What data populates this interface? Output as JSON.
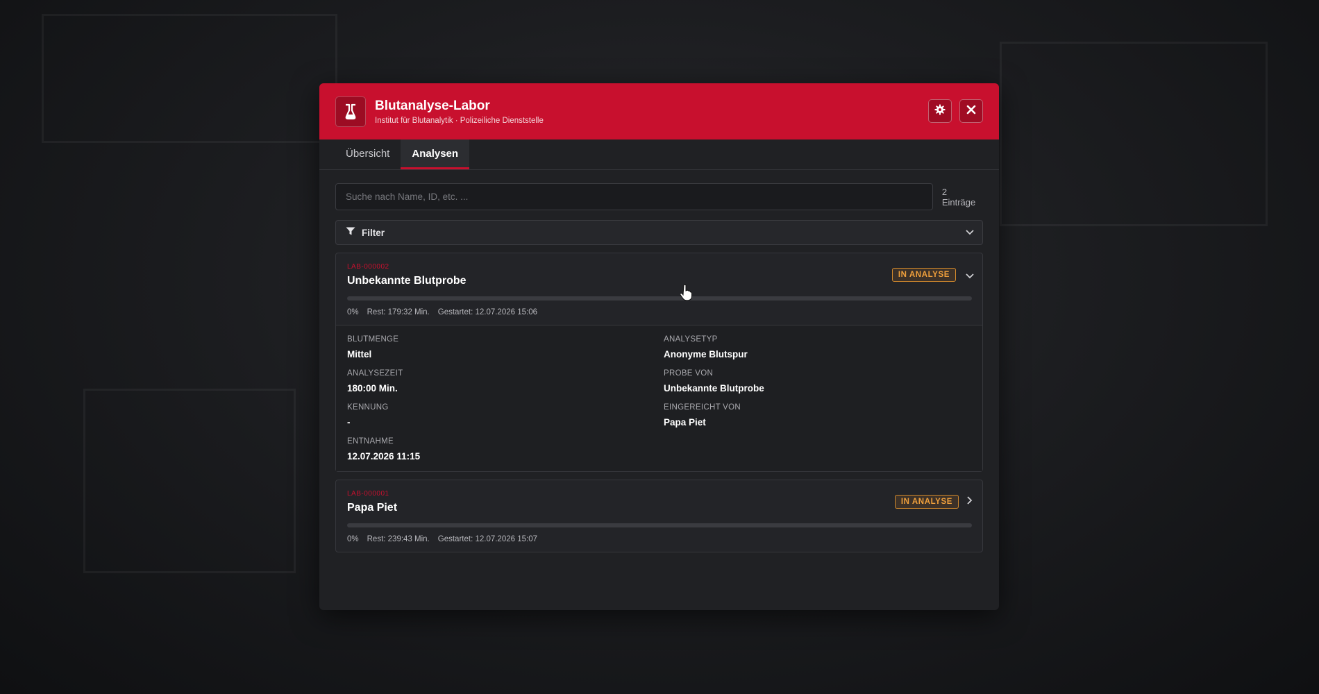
{
  "header": {
    "title": "Blutanalyse-Labor",
    "subtitle": "Institut für Blutanalytik · Polizeiliche Dienststelle"
  },
  "tabs": [
    {
      "label": "Übersicht",
      "active": false
    },
    {
      "label": "Analysen",
      "active": true
    }
  ],
  "search": {
    "placeholder": "Suche nach Name, ID, etc. ...",
    "value": "",
    "count_label": "2 Einträge"
  },
  "filter": {
    "label": "Filter"
  },
  "analyses": [
    {
      "id": "LAB-000002",
      "name": "Unbekannte Blutprobe",
      "status": "IN ANALYSE",
      "progress_percent": 0,
      "progress_label": "0%",
      "rest_label": "Rest: 179:32 Min.",
      "started_label": "Gestartet: 12.07.2026 15:06",
      "expanded": true,
      "details": {
        "blutmenge_label": "BLUTMENGE",
        "blutmenge": "Mittel",
        "analysetyp_label": "ANALYSETYP",
        "analysetyp": "Anonyme Blutspur",
        "analysezeit_label": "ANALYSEZEIT",
        "analysezeit": "180:00 Min.",
        "probe_von_label": "PROBE VON",
        "probe_von": "Unbekannte Blutprobe",
        "kennung_label": "KENNUNG",
        "kennung": "-",
        "eingereicht_von_label": "EINGEREICHT VON",
        "eingereicht_von": "Papa Piet",
        "entnahme_label": "ENTNAHME",
        "entnahme": "12.07.2026 11:15"
      }
    },
    {
      "id": "LAB-000001",
      "name": "Papa Piet",
      "status": "IN ANALYSE",
      "progress_percent": 0,
      "progress_label": "0%",
      "rest_label": "Rest: 239:43 Min.",
      "started_label": "Gestartet: 12.07.2026 15:07",
      "expanded": false
    }
  ],
  "colors": {
    "accent": "#c8102e",
    "status_orange": "#f0a03c",
    "panel": "#202124"
  },
  "icons": {
    "logo": "flask-icon",
    "settings": "gear-icon",
    "close": "close-icon",
    "filter": "filter-icon"
  }
}
